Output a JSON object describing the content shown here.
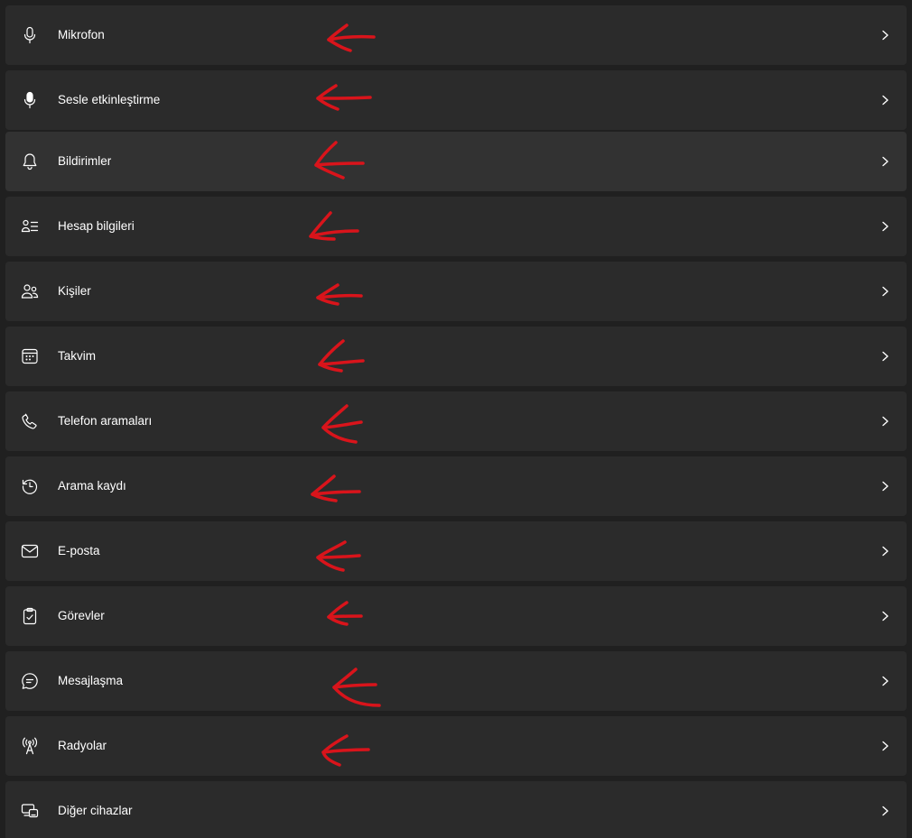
{
  "settings_list": {
    "items": [
      {
        "label": "Mikrofon",
        "icon": "microphone-icon"
      },
      {
        "label": "Sesle etkinleştirme",
        "icon": "voice-activation-microphone-icon"
      },
      {
        "label": "Bildirimler",
        "icon": "bell-icon"
      },
      {
        "label": "Hesap bilgileri",
        "icon": "account-info-icon"
      },
      {
        "label": "Kişiler",
        "icon": "people-icon"
      },
      {
        "label": "Takvim",
        "icon": "calendar-icon"
      },
      {
        "label": "Telefon aramaları",
        "icon": "phone-icon"
      },
      {
        "label": "Arama kaydı",
        "icon": "history-icon"
      },
      {
        "label": "E-posta",
        "icon": "mail-icon"
      },
      {
        "label": "Görevler",
        "icon": "clipboard-check-icon"
      },
      {
        "label": "Mesajlaşma",
        "icon": "chat-bubble-icon"
      },
      {
        "label": "Radyolar",
        "icon": "radio-antenna-icon"
      },
      {
        "label": "Diğer cihazlar",
        "icon": "devices-icon"
      }
    ]
  },
  "annotation": {
    "arrow_color": "#d9141b"
  },
  "colors": {
    "background": "#202020",
    "row": "#2b2b2b",
    "row_hover": "#323232",
    "text": "#ffffff"
  }
}
